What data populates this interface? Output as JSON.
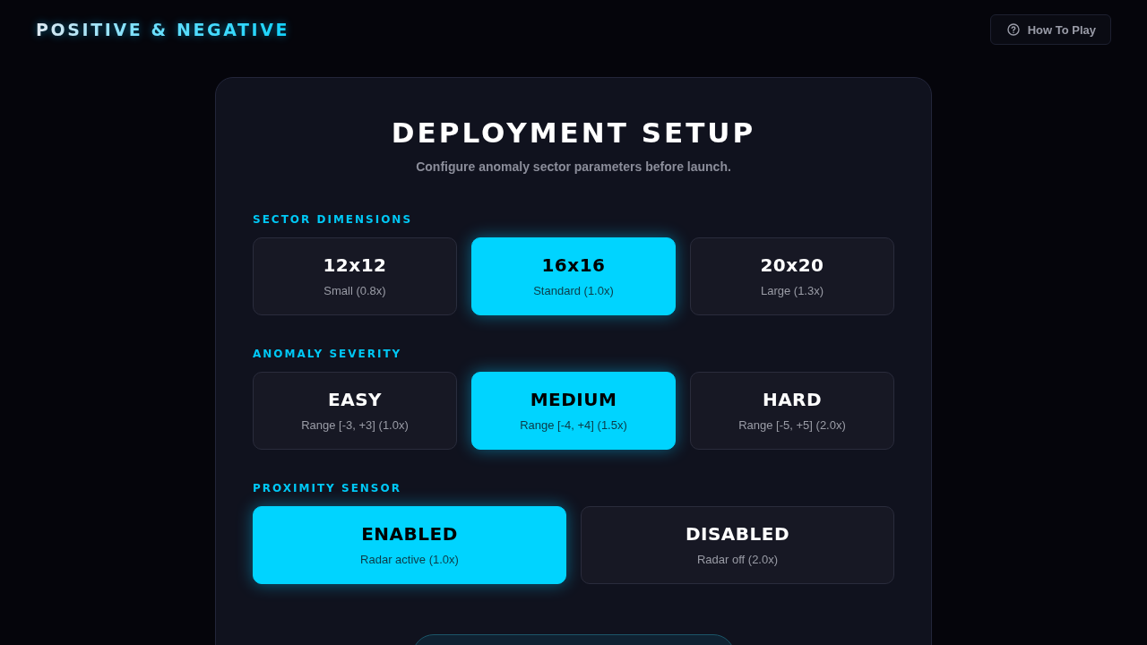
{
  "header": {
    "title": "POSITIVE & NEGATIVE",
    "help_button": "How To Play"
  },
  "setup": {
    "title": "DEPLOYMENT SETUP",
    "subtitle": "Configure anomaly sector parameters before launch.",
    "sections": [
      {
        "label": "SECTOR DIMENSIONS",
        "options": [
          {
            "name": "12x12",
            "detail": "Small (0.8x)",
            "selected": false
          },
          {
            "name": "16x16",
            "detail": "Standard (1.0x)",
            "selected": true
          },
          {
            "name": "20x20",
            "detail": "Large (1.3x)",
            "selected": false
          }
        ]
      },
      {
        "label": "ANOMALY SEVERITY",
        "options": [
          {
            "name": "EASY",
            "detail": "Range [-3, +3] (1.0x)",
            "selected": false
          },
          {
            "name": "MEDIUM",
            "detail": "Range [-4, +4] (1.5x)",
            "selected": true
          },
          {
            "name": "HARD",
            "detail": "Range [-5, +5] (2.0x)",
            "selected": false
          }
        ]
      },
      {
        "label": "PROXIMITY SENSOR",
        "options": [
          {
            "name": "ENABLED",
            "detail": "Radar active (1.0x)",
            "selected": true
          },
          {
            "name": "DISABLED",
            "detail": "Radar off (2.0x)",
            "selected": false
          }
        ]
      }
    ]
  }
}
